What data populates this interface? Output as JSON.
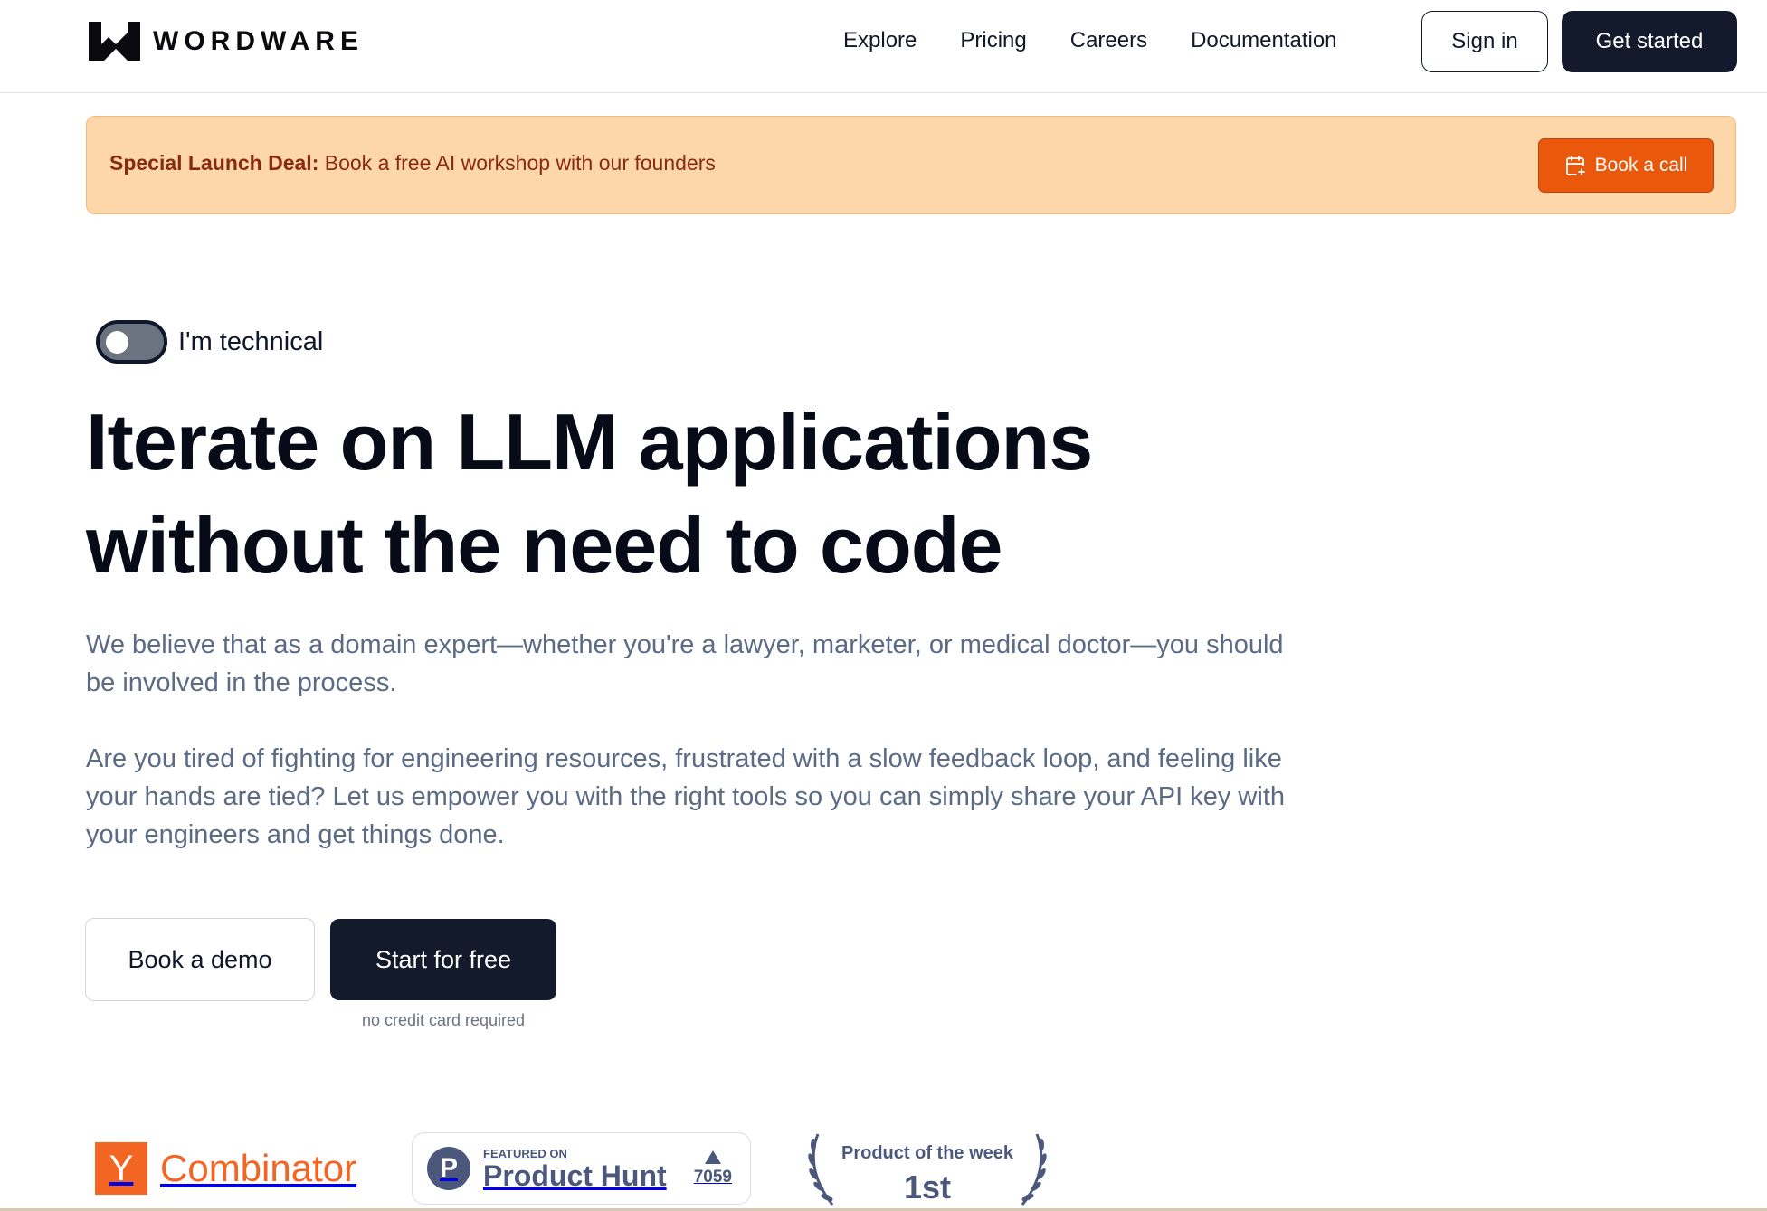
{
  "header": {
    "brand": "WORDWARE",
    "nav": [
      {
        "label": "Explore"
      },
      {
        "label": "Pricing"
      },
      {
        "label": "Careers"
      },
      {
        "label": "Documentation"
      }
    ],
    "sign_in_label": "Sign in",
    "get_started_label": "Get started"
  },
  "banner": {
    "bold": "Special Launch Deal:",
    "text": " Book a free AI workshop with our founders",
    "button_label": "Book a call",
    "button_icon": "calendar-plus-icon",
    "colors": {
      "background": "#fdd6aa",
      "text": "#8a2b0e",
      "button": "#ea580c"
    }
  },
  "hero": {
    "toggle_label": "I'm technical",
    "toggle_on": false,
    "headline_line1": "Iterate on LLM applications",
    "headline_line2": "without the need to code",
    "paragraph1": "We believe that as a domain expert—whether you're a lawyer, marketer, or medical doctor—you should be involved in the process.",
    "paragraph2": "Are you tired of fighting for engineering resources, frustrated with a slow feedback loop, and feeling like your hands are tied? Let us empower you with the right tools so you can simply share your API key with your engineers and get things done.",
    "demo_label": "Book a demo",
    "free_label": "Start for free",
    "note": "no credit card required"
  },
  "badges": {
    "yc": {
      "letter": "Y",
      "name": "Combinator"
    },
    "product_hunt": {
      "logo_letter": "P",
      "featured": "FEATURED ON",
      "name": "Product Hunt",
      "votes": "7059"
    },
    "product_of_week": {
      "title": "Product of the week",
      "rank": "1st"
    }
  }
}
